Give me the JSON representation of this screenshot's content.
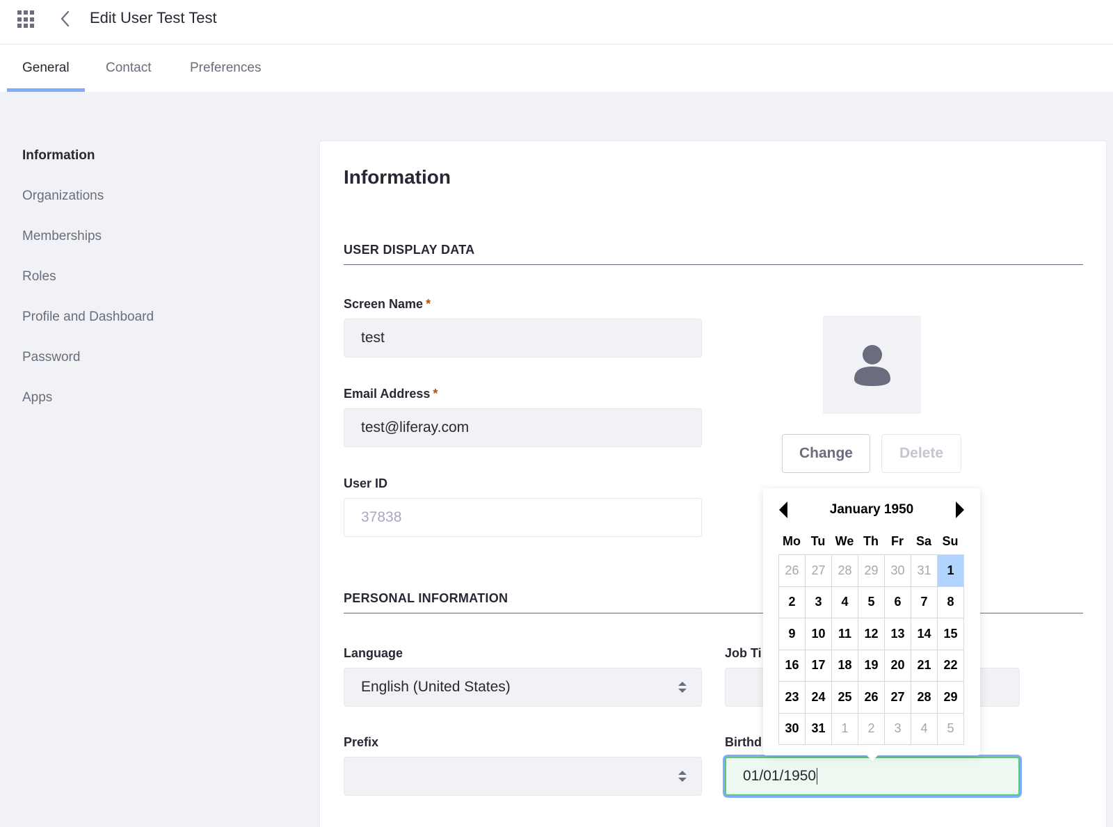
{
  "header": {
    "title": "Edit User Test Test"
  },
  "tabs": [
    "General",
    "Contact",
    "Preferences"
  ],
  "sidebar": {
    "items": [
      {
        "label": "Information"
      },
      {
        "label": "Organizations"
      },
      {
        "label": "Memberships"
      },
      {
        "label": "Roles"
      },
      {
        "label": "Profile and Dashboard"
      },
      {
        "label": "Password"
      },
      {
        "label": "Apps"
      }
    ]
  },
  "panel": {
    "title": "Information",
    "section_display": "USER DISPLAY DATA",
    "section_personal": "PERSONAL INFORMATION"
  },
  "fields": {
    "screen_name": {
      "label": "Screen Name",
      "value": "test",
      "required": "*"
    },
    "email": {
      "label": "Email Address",
      "value": "test@liferay.com",
      "required": "*"
    },
    "user_id": {
      "label": "User ID",
      "placeholder": "37838"
    },
    "language": {
      "label": "Language",
      "value": "English (United States)"
    },
    "job_title": {
      "label": "Job Ti"
    },
    "prefix": {
      "label": "Prefix",
      "value": ""
    },
    "birthday": {
      "label": "Birthd",
      "value": "01/01/1950"
    }
  },
  "avatar_buttons": {
    "change": "Change",
    "delete": "Delete"
  },
  "datepicker": {
    "month": "January 1950",
    "weekdays": [
      "Mo",
      "Tu",
      "We",
      "Th",
      "Fr",
      "Sa",
      "Su"
    ],
    "days": [
      {
        "d": "26",
        "other": true
      },
      {
        "d": "27",
        "other": true
      },
      {
        "d": "28",
        "other": true
      },
      {
        "d": "29",
        "other": true
      },
      {
        "d": "30",
        "other": true
      },
      {
        "d": "31",
        "other": true
      },
      {
        "d": "1",
        "selected": true
      },
      {
        "d": "2"
      },
      {
        "d": "3"
      },
      {
        "d": "4"
      },
      {
        "d": "5"
      },
      {
        "d": "6"
      },
      {
        "d": "7"
      },
      {
        "d": "8"
      },
      {
        "d": "9"
      },
      {
        "d": "10"
      },
      {
        "d": "11"
      },
      {
        "d": "12"
      },
      {
        "d": "13"
      },
      {
        "d": "14"
      },
      {
        "d": "15"
      },
      {
        "d": "16"
      },
      {
        "d": "17"
      },
      {
        "d": "18"
      },
      {
        "d": "19"
      },
      {
        "d": "20"
      },
      {
        "d": "21"
      },
      {
        "d": "22"
      },
      {
        "d": "23"
      },
      {
        "d": "24"
      },
      {
        "d": "25"
      },
      {
        "d": "26"
      },
      {
        "d": "27"
      },
      {
        "d": "28"
      },
      {
        "d": "29"
      },
      {
        "d": "30"
      },
      {
        "d": "31"
      },
      {
        "d": "1",
        "other": true
      },
      {
        "d": "2",
        "other": true
      },
      {
        "d": "3",
        "other": true
      },
      {
        "d": "4",
        "other": true
      },
      {
        "d": "5",
        "other": true
      }
    ]
  },
  "icons": {
    "apps": "apps-grid-icon",
    "back": "chevron-left-icon",
    "avatar": "user-icon",
    "select": "select-arrows-icon",
    "prev": "caret-left-icon",
    "next": "caret-right-icon"
  },
  "colors": {
    "tab_indicator": "#80acff",
    "required": "#b95000",
    "focus_border": "#5aca75",
    "selected_day": "#b3d3ff"
  }
}
